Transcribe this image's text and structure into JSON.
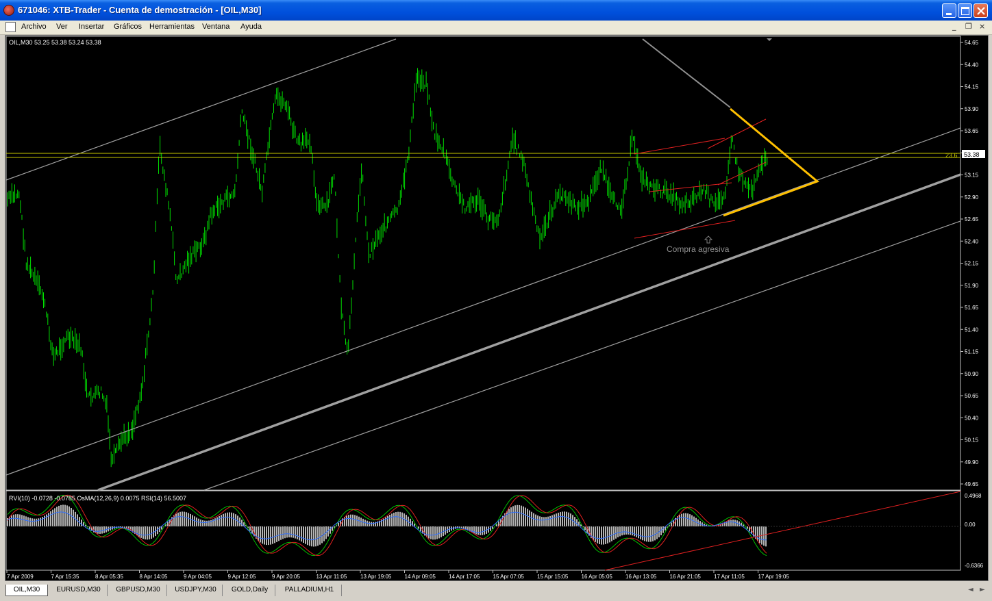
{
  "window": {
    "title": "671046: XTB-Trader - Cuenta de demostración - [OIL,M30]",
    "buttons": [
      "minimize-icon",
      "maximize-icon",
      "close-icon"
    ]
  },
  "menu": {
    "items": [
      "Archivo",
      "Ver",
      "Insertar",
      "Gráficos",
      "Herramientas",
      "Ventana",
      "Ayuda"
    ],
    "mdi_controls": [
      "_",
      "❐",
      "×"
    ]
  },
  "chart": {
    "symbol_info": "OIL,M30  53.25 53.38 53.24 53.38",
    "price_axis": [
      "54.65",
      "54.40",
      "54.15",
      "53.90",
      "53.65",
      "53.40",
      "53.15",
      "52.90",
      "52.65",
      "52.40",
      "52.15",
      "51.90",
      "51.65",
      "51.40",
      "51.15",
      "50.90",
      "50.65",
      "50.40",
      "50.15",
      "49.90",
      "49.65"
    ],
    "price_range": [
      49.65,
      54.65
    ],
    "current_price": "53.38",
    "fib_label": "23.6",
    "annotation": "Compra agresiva",
    "colors": {
      "bg": "#000000",
      "candles": "#00ff00",
      "channel": "#a0a0a0",
      "triangle": "#ffc000",
      "trendlines": "#ff2020",
      "hline": "#c8c800"
    }
  },
  "indicator": {
    "label": "RVI(10) -0.0728 -0.0785  OsMA(12,26,9) 0.0075  RSI(14) 56.5007",
    "axis": [
      "0.4968",
      "0.00",
      "-0.6366"
    ],
    "range": [
      -0.6366,
      0.4968
    ]
  },
  "time_axis": [
    "7 Apr 2009",
    "7 Apr 15:35",
    "8 Apr 05:35",
    "8 Apr 14:05",
    "9 Apr 04:05",
    "9 Apr 12:05",
    "9 Apr 20:05",
    "13 Apr 11:05",
    "13 Apr 19:05",
    "14 Apr 09:05",
    "14 Apr 17:05",
    "15 Apr 07:05",
    "15 Apr 15:05",
    "16 Apr 05:05",
    "16 Apr 13:05",
    "16 Apr 21:05",
    "17 Apr 11:05",
    "17 Apr 19:05"
  ],
  "tabs": [
    "OIL,M30",
    "EURUSD,M30",
    "GBPUSD,M30",
    "USDJPY,M30",
    "GOLD,Daily",
    "PALLADIUM,H1"
  ],
  "tab_scroll": [
    "◄",
    "►"
  ]
}
